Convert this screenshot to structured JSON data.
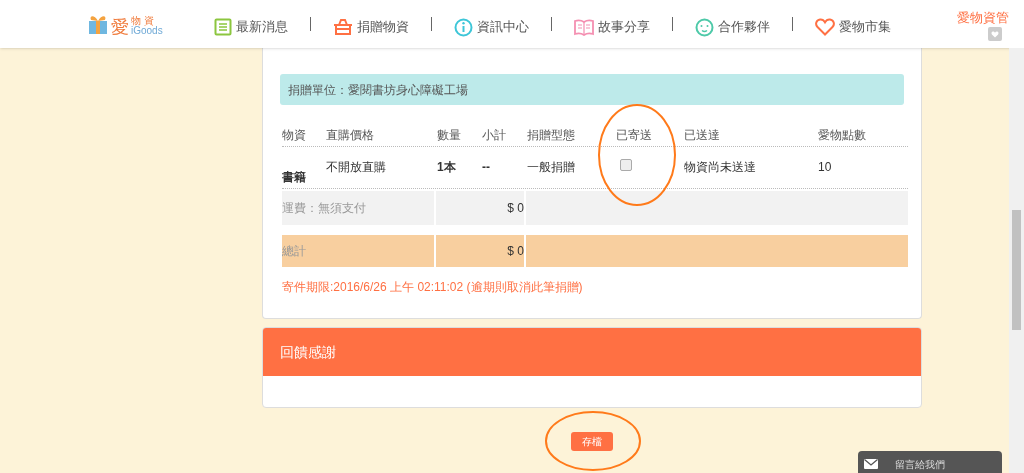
{
  "header": {
    "logo": {
      "mark": "愛",
      "sub": "物 資",
      "brand": "iGoods"
    },
    "nav": [
      {
        "label": "最新消息",
        "kind": "list"
      },
      {
        "label": "捐贈物資",
        "kind": "gift"
      },
      {
        "label": "資訊中心",
        "kind": "info"
      },
      {
        "label": "故事分享",
        "kind": "book"
      },
      {
        "label": "合作夥伴",
        "kind": "smile"
      },
      {
        "label": "愛物市集",
        "kind": "heart"
      }
    ],
    "admin_link": "愛物資管"
  },
  "donation": {
    "unit_label": "捐贈單位：愛閱書坊身心障礙工場",
    "columns": [
      "物資",
      "直購價格",
      "數量",
      "小計",
      "捐贈型態",
      "已寄送",
      "已送達",
      "愛物點數"
    ],
    "rows": [
      {
        "item": "書籍",
        "price": "不開放直購",
        "qty": "1本",
        "subtotal": "--",
        "type": "一般捐贈",
        "shipped": false,
        "arrived": "物資尚未送達",
        "points": "10"
      }
    ],
    "shipping": {
      "label": "運費：無須支付",
      "amount": "$ 0"
    },
    "total": {
      "label": "總計",
      "amount": "$ 0"
    },
    "deadline": "寄件期限:2016/6/26 上午 02:11:02 (逾期則取消此筆捐贈)"
  },
  "feedback": {
    "title": "回饋感謝"
  },
  "save_button": "存檔",
  "contact_widget": "留言給我們"
}
